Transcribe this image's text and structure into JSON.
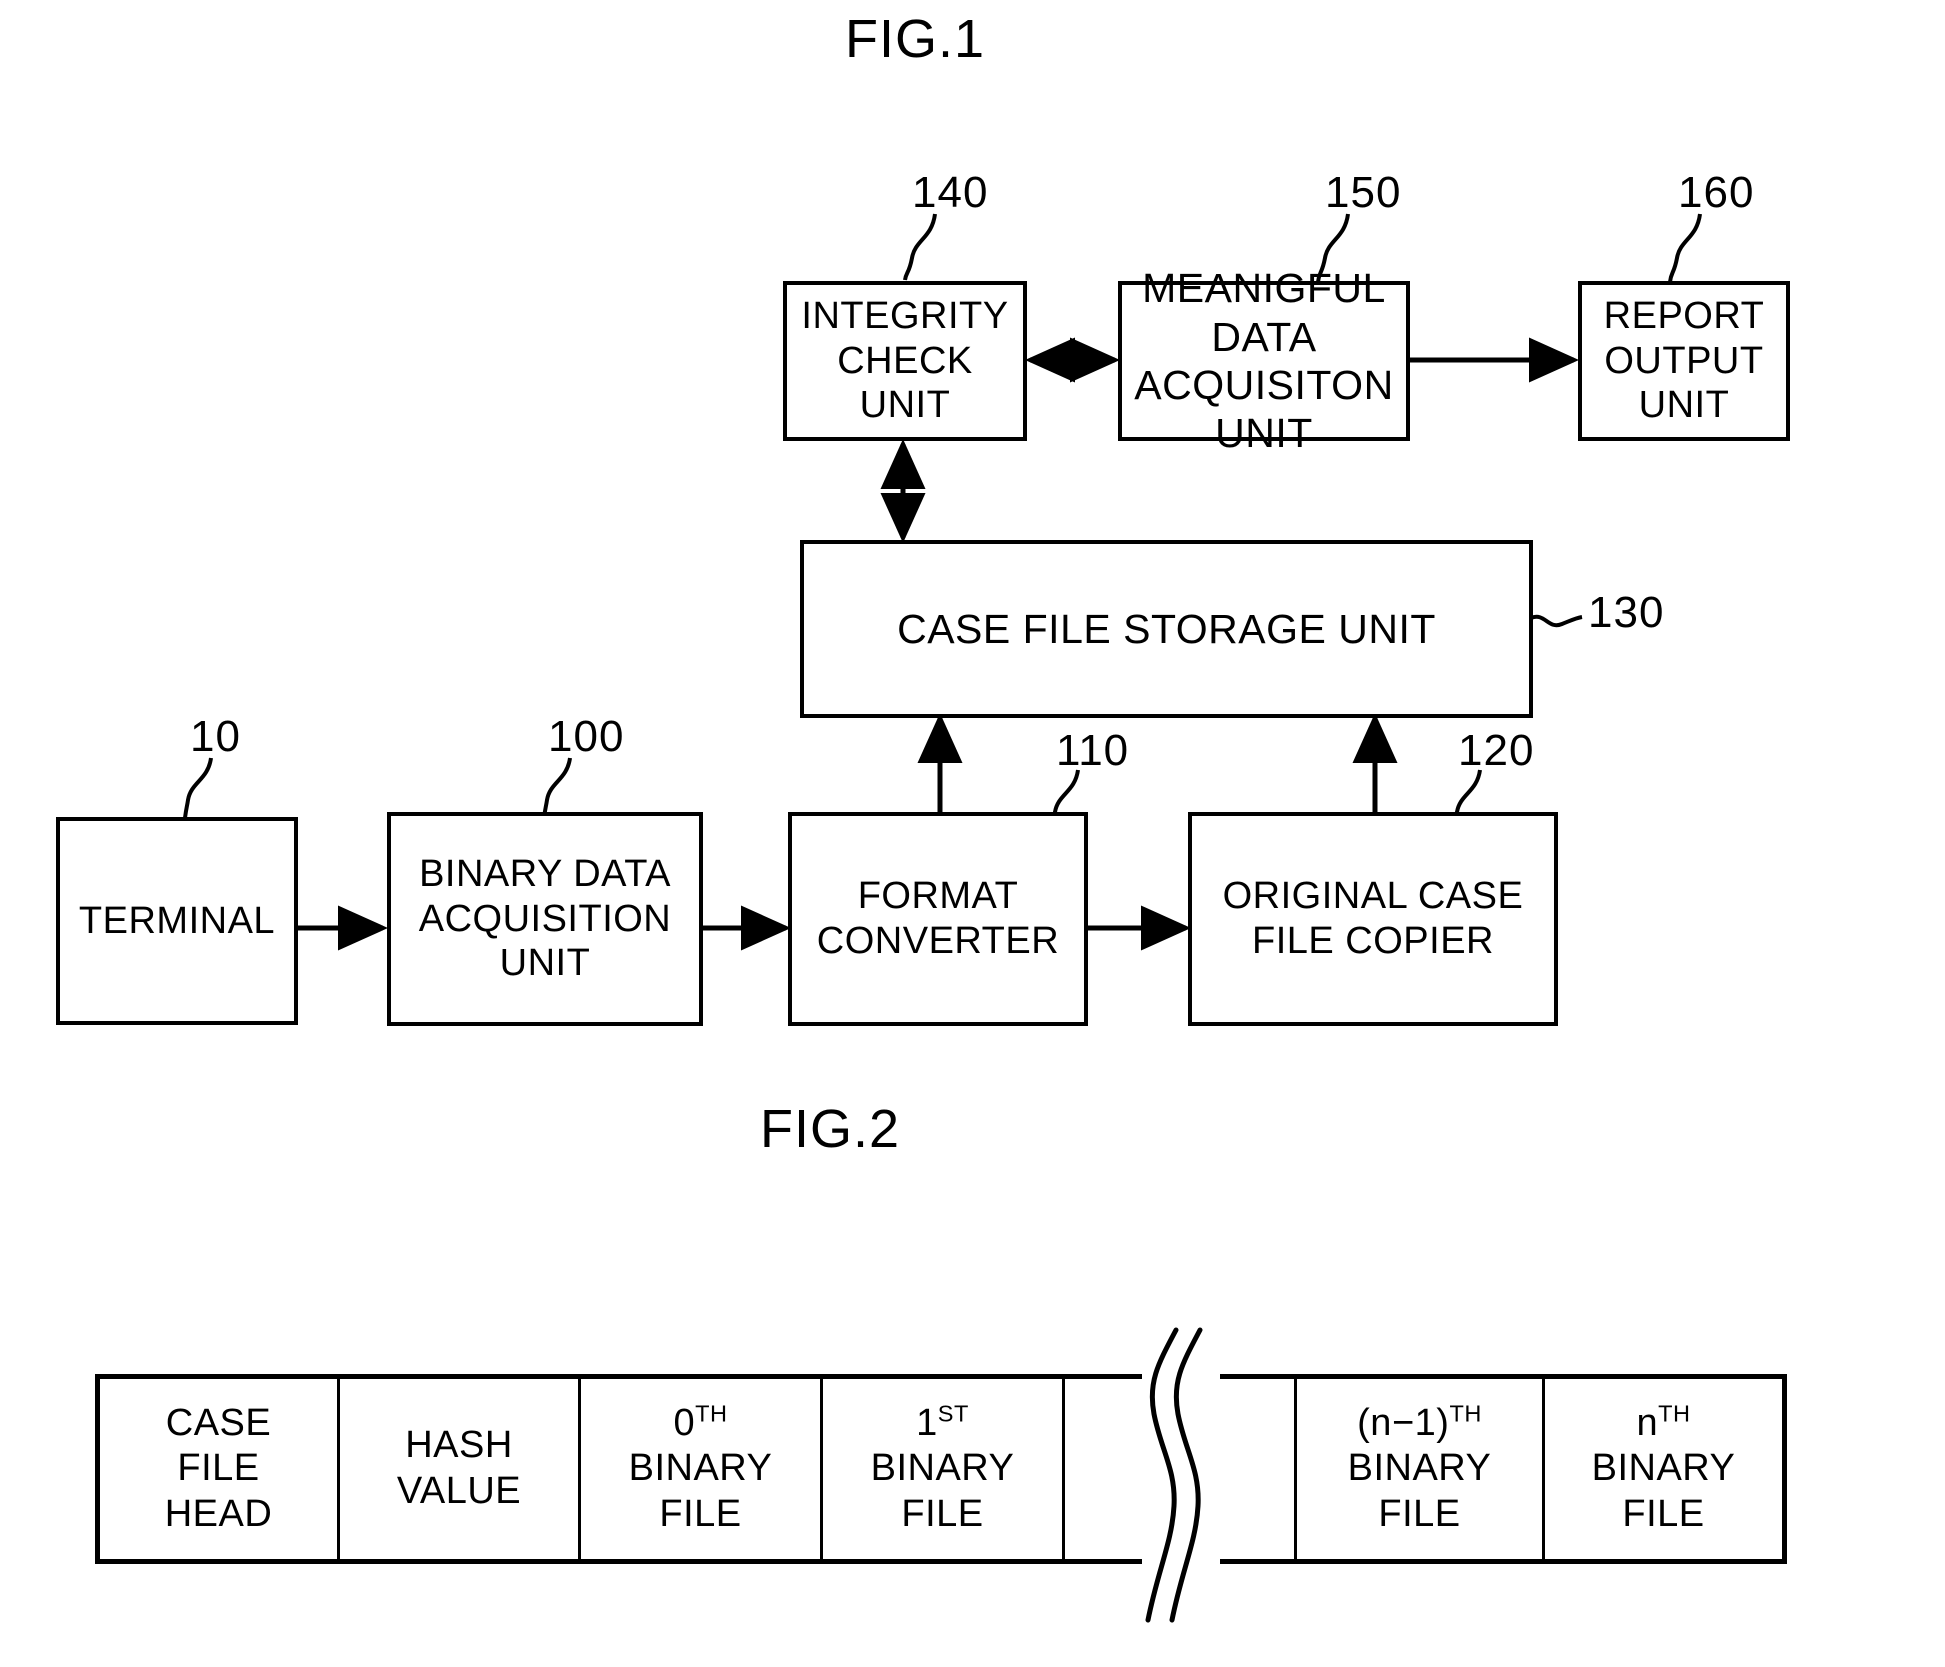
{
  "figures": [
    {
      "id": "fig1",
      "title": "FIG.1",
      "blocks": [
        {
          "ref": "140",
          "label": "INTEGRITY\nCHECK\nUNIT"
        },
        {
          "ref": "150",
          "label": "MEANIGFUL DATA\nACQUISITON UNIT"
        },
        {
          "ref": "160",
          "label": "REPORT\nOUTPUT\nUNIT"
        },
        {
          "ref": "130",
          "label": "CASE FILE STORAGE UNIT"
        },
        {
          "ref": "10",
          "label": "TERMINAL"
        },
        {
          "ref": "100",
          "label": "BINARY DATA\nACQUISITION\nUNIT"
        },
        {
          "ref": "110",
          "label": "FORMAT\nCONVERTER"
        },
        {
          "ref": "120",
          "label": "ORIGINAL CASE\nFILE COPIER"
        }
      ]
    },
    {
      "id": "fig2",
      "title": "FIG.2",
      "cells": [
        {
          "main": "CASE\nFILE\nHEAD",
          "ordinal": "",
          "sup": ""
        },
        {
          "main": "HASH\nVALUE",
          "ordinal": "",
          "sup": ""
        },
        {
          "main": "BINARY\nFILE",
          "ordinal": "0",
          "sup": "TH"
        },
        {
          "main": "BINARY\nFILE",
          "ordinal": "1",
          "sup": "ST"
        },
        {
          "main": "",
          "ordinal": "",
          "sup": ""
        },
        {
          "main": "BINARY\nFILE",
          "ordinal": "(n−1)",
          "sup": "TH"
        },
        {
          "main": "BINARY\nFILE",
          "ordinal": "n",
          "sup": "TH"
        }
      ]
    }
  ],
  "fig1": {
    "title": "FIG.1",
    "blocks": {
      "integrity_check": {
        "label": "INTEGRITY\nCHECK\nUNIT",
        "ref": "140"
      },
      "meaningful_data": {
        "label": "MEANIGFUL DATA\nACQUISITON UNIT",
        "ref": "150"
      },
      "report_output": {
        "label": "REPORT\nOUTPUT\nUNIT",
        "ref": "160"
      },
      "case_file_storage": {
        "label": "CASE FILE STORAGE UNIT",
        "ref": "130"
      },
      "terminal": {
        "label": "TERMINAL",
        "ref": "10"
      },
      "binary_data_acquisition": {
        "label": "BINARY DATA\nACQUISITION\nUNIT",
        "ref": "100"
      },
      "format_converter": {
        "label": "FORMAT\nCONVERTER",
        "ref": "110"
      },
      "original_case_file_copier": {
        "label": "ORIGINAL CASE\nFILE COPIER",
        "ref": "120"
      }
    }
  },
  "fig2": {
    "title": "FIG.2",
    "cells": {
      "case_file_head": "CASE\nFILE\nHEAD",
      "hash_value": "HASH\nVALUE",
      "binary_0_ordinal": "0",
      "binary_0_sup": "TH",
      "binary_0_main": "BINARY\nFILE",
      "binary_1_ordinal": "1",
      "binary_1_sup": "ST",
      "binary_1_main": "BINARY\nFILE",
      "binary_n_minus_1_ordinal": "(n−1)",
      "binary_n_minus_1_sup": "TH",
      "binary_n_minus_1_main": "BINARY\nFILE",
      "binary_n_ordinal": "n",
      "binary_n_sup": "TH",
      "binary_n_main": "BINARY\nFILE"
    }
  },
  "colors": {
    "ink": "#000000",
    "paper": "#ffffff"
  }
}
